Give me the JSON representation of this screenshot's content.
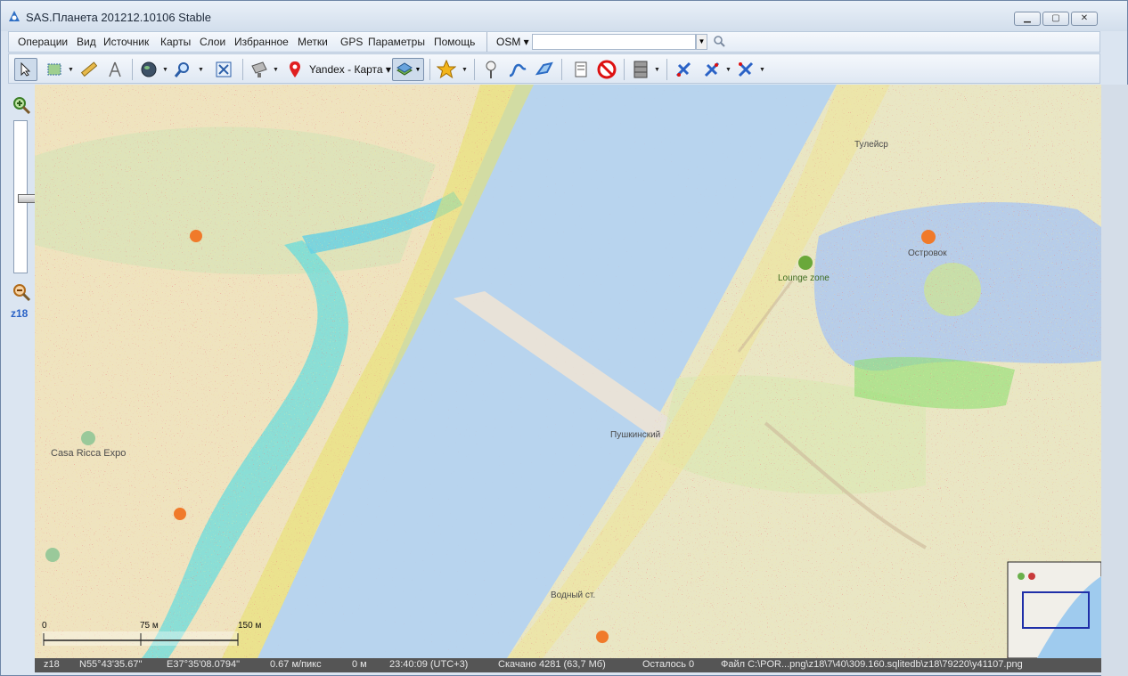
{
  "window": {
    "title": "SAS.Планета 201212.10106 Stable"
  },
  "menu": {
    "items": [
      "Операции",
      "Вид",
      "Источник",
      "Карты",
      "Слои",
      "Избранное",
      "Метки",
      "GPS",
      "Параметры",
      "Помощь"
    ],
    "search_source": "OSM"
  },
  "toolbar": {
    "map_name": "Yandex - Карта"
  },
  "zoom": {
    "level_label": "z18"
  },
  "map": {
    "labels": {
      "casa_ricca": "Casa Ricca Expo",
      "ostrov": "Островок",
      "lounge": "Lounge zone",
      "pushkinskiy": "Пушкинский",
      "vodnoy": "Водный ст.",
      "tuyleur": "Тулейср"
    },
    "scale": {
      "zero": "0",
      "mid": "75 м",
      "end": "150 м"
    }
  },
  "status": {
    "zoom": "z18",
    "lat": "N55°43'35.67\"",
    "lon": "E37°35'08.0794\"",
    "resolution": "0.67 м/пикс",
    "distance": "0 м",
    "time": "23:40:09 (UTC+3)",
    "downloaded": "Скачано 4281 (63,7 Мб)",
    "remaining": "Осталось 0",
    "file": "Файл C:\\POR...png\\z18\\7\\40\\309.160.sqlitedb\\z18\\79220\\y41107.png"
  },
  "colors": {
    "water": "#b8d4ee",
    "land": "#efe6c8",
    "park": "#cfe3b6",
    "noise_red": "#d8383f",
    "noise_yellow": "#e6e05a",
    "noise_cyan": "#46d6e0"
  }
}
